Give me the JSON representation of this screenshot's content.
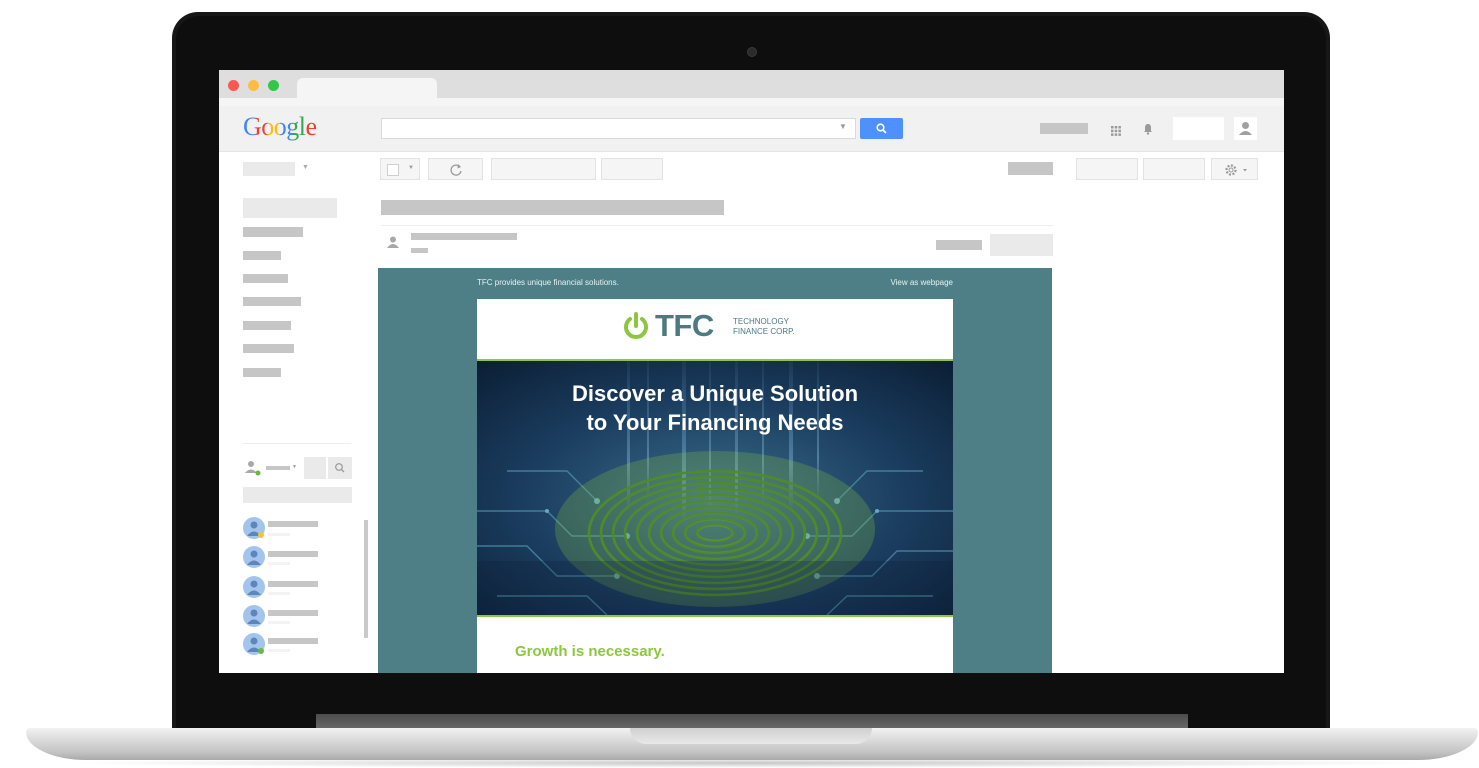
{
  "gmail": {
    "logo_text": "Google",
    "search_button_icon": "search-icon",
    "refresh_icon": "refresh-icon",
    "settings_icon": "gear-icon",
    "account_icon": "person-icon",
    "apps_icon": "apps-grid-icon",
    "notifications_icon": "bell-icon"
  },
  "email": {
    "preheader": "TFC provides unique financial solutions.",
    "view_as_webpage": "View as webpage",
    "brand": {
      "name": "TFC",
      "line1": "TECHNOLOGY",
      "line2": "FINANCE CORP."
    },
    "hero_line1": "Discover a Unique Solution",
    "hero_line2": "to Your Financing Needs",
    "body_heading": "Growth is necessary."
  },
  "colors": {
    "logo_blue": "#4285f4",
    "logo_red": "#ea4335",
    "logo_yellow": "#fbbc05",
    "logo_green": "#34a853",
    "search_button": "#4d90fe",
    "email_bg": "#4e7f87",
    "brand_green": "#8dc63f",
    "brand_teal": "#4b7a83"
  }
}
